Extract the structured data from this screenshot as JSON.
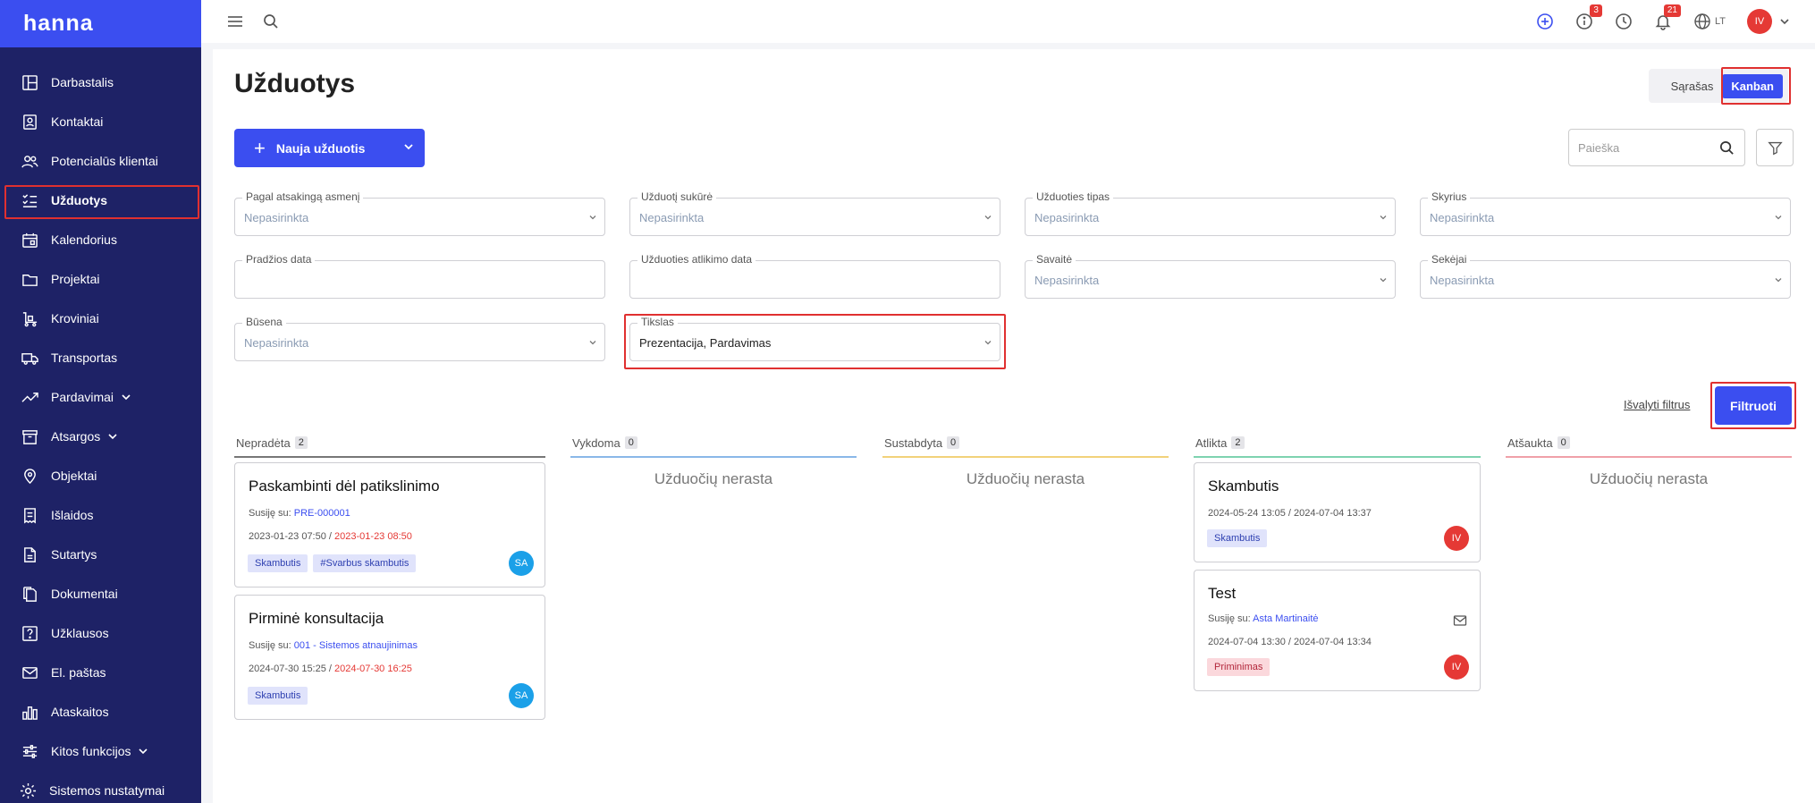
{
  "app": {
    "logo": "hanna"
  },
  "sidebar": {
    "items": [
      {
        "label": "Darbastalis",
        "icon": "dashboard-icon"
      },
      {
        "label": "Kontaktai",
        "icon": "contacts-icon"
      },
      {
        "label": "Potencialūs klientai",
        "icon": "leads-icon"
      },
      {
        "label": "Užduotys",
        "icon": "tasks-icon",
        "active": true
      },
      {
        "label": "Kalendorius",
        "icon": "calendar-icon"
      },
      {
        "label": "Projektai",
        "icon": "folder-icon"
      },
      {
        "label": "Kroviniai",
        "icon": "cargo-icon"
      },
      {
        "label": "Transportas",
        "icon": "truck-icon"
      },
      {
        "label": "Pardavimai",
        "icon": "trend-icon",
        "expandable": true
      },
      {
        "label": "Atsargos",
        "icon": "archive-icon",
        "expandable": true
      },
      {
        "label": "Objektai",
        "icon": "pin-icon"
      },
      {
        "label": "Išlaidos",
        "icon": "receipt-icon"
      },
      {
        "label": "Sutartys",
        "icon": "contract-icon"
      },
      {
        "label": "Dokumentai",
        "icon": "documents-icon"
      },
      {
        "label": "Užklausos",
        "icon": "question-icon"
      },
      {
        "label": "El. paštas",
        "icon": "mail-icon"
      },
      {
        "label": "Ataskaitos",
        "icon": "reports-icon"
      },
      {
        "label": "Kitos funkcijos",
        "icon": "sliders-icon",
        "expandable": true
      },
      {
        "label": "Sistemos nustatymai",
        "icon": "gear-icon"
      }
    ]
  },
  "topbar": {
    "info_badge": "3",
    "notifications_badge": "21",
    "language": "LT",
    "user_initials": "IV"
  },
  "page": {
    "title": "Užduotys",
    "view_list": "Sąrašas",
    "view_kanban": "Kanban",
    "new_task": "Nauja užduotis",
    "search_placeholder": "Paieška"
  },
  "filters": {
    "responsible": {
      "label": "Pagal atsakingą asmenį",
      "value": "Nepasirinkta"
    },
    "creator": {
      "label": "Užduotį sukūrė",
      "value": "Nepasirinkta"
    },
    "type": {
      "label": "Užduoties tipas",
      "value": "Nepasirinkta"
    },
    "department": {
      "label": "Skyrius",
      "value": "Nepasirinkta"
    },
    "start_date": {
      "label": "Pradžios data",
      "value": ""
    },
    "done_date": {
      "label": "Užduoties atlikimo data",
      "value": ""
    },
    "week": {
      "label": "Savaitė",
      "value": "Nepasirinkta"
    },
    "followers": {
      "label": "Sekėjai",
      "value": "Nepasirinkta"
    },
    "status": {
      "label": "Būsena",
      "value": "Nepasirinkta"
    },
    "goal": {
      "label": "Tikslas",
      "value": "Prezentacija, Pardavimas"
    },
    "clear": "Išvalyti filtrus",
    "apply": "Filtruoti"
  },
  "kanban": {
    "columns": [
      {
        "name": "Nepradėta",
        "count": "2",
        "color": "#777777"
      },
      {
        "name": "Vykdoma",
        "count": "0",
        "color": "#8ab8e8",
        "empty": "Užduočių nerasta"
      },
      {
        "name": "Sustabdyta",
        "count": "0",
        "color": "#f2d27a",
        "empty": "Užduočių nerasta"
      },
      {
        "name": "Atlikta",
        "count": "2",
        "color": "#7ed3b0"
      },
      {
        "name": "Atšaukta",
        "count": "0",
        "color": "#f0a0a8",
        "empty": "Užduočių nerasta"
      }
    ],
    "cards": {
      "c1": {
        "title": "Paskambinti dėl patikslinimo",
        "rel_prefix": "Susiję su:",
        "rel_link": "PRE-000001",
        "date_start": "2023-01-23 07:50 /",
        "date_end": "2023-01-23 08:50",
        "tags": [
          "Skambutis",
          "#Svarbus skambutis"
        ],
        "avatar": "SA"
      },
      "c2": {
        "title": "Pirminė konsultacija",
        "rel_prefix": "Susiję su:",
        "rel_link": "001 - Sistemos atnaujinimas",
        "date_start": "2024-07-30 15:25 /",
        "date_end": "2024-07-30 16:25",
        "tags": [
          "Skambutis"
        ],
        "avatar": "SA"
      },
      "c3": {
        "title": "Skambutis",
        "date": "2024-05-24 13:05 / 2024-07-04 13:37",
        "tags": [
          "Skambutis"
        ],
        "avatar": "IV"
      },
      "c4": {
        "title": "Test",
        "rel_prefix": "Susiję su:",
        "rel_link": "Asta Martinaitė",
        "date": "2024-07-04 13:30 / 2024-07-04 13:34",
        "tags": [
          "Priminimas"
        ],
        "avatar": "IV"
      }
    }
  }
}
